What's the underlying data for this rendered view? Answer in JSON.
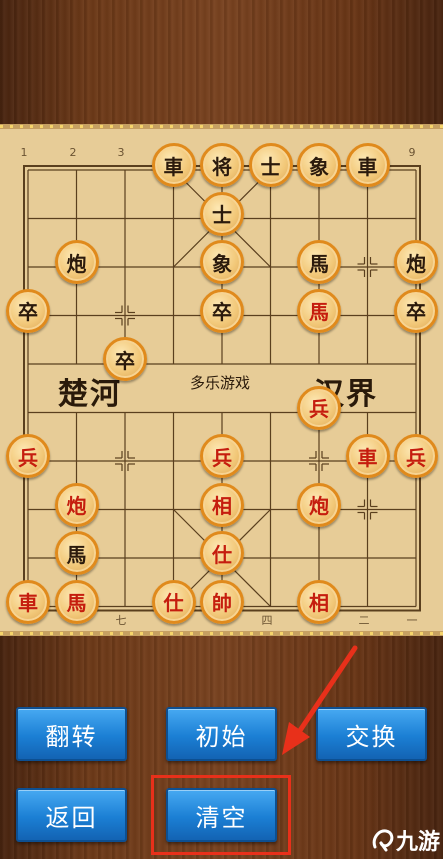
{
  "board": {
    "file_numbers_top": [
      "1",
      "2",
      "3",
      "9"
    ],
    "file_numbers_bottom": [
      "七",
      "四",
      "二",
      "一"
    ],
    "river": {
      "left": "楚河",
      "center": "多乐游戏",
      "right": "汉界"
    }
  },
  "pieces": [
    {
      "char": "車",
      "side": "black",
      "col": 3,
      "row": 0
    },
    {
      "char": "将",
      "side": "black",
      "col": 4,
      "row": 0
    },
    {
      "char": "士",
      "side": "black",
      "col": 5,
      "row": 0
    },
    {
      "char": "象",
      "side": "black",
      "col": 6,
      "row": 0
    },
    {
      "char": "車",
      "side": "black",
      "col": 7,
      "row": 0
    },
    {
      "char": "士",
      "side": "black",
      "col": 4,
      "row": 1
    },
    {
      "char": "炮",
      "side": "black",
      "col": 1,
      "row": 2
    },
    {
      "char": "象",
      "side": "black",
      "col": 4,
      "row": 2
    },
    {
      "char": "馬",
      "side": "black",
      "col": 6,
      "row": 2
    },
    {
      "char": "炮",
      "side": "black",
      "col": 8,
      "row": 2
    },
    {
      "char": "卒",
      "side": "black",
      "col": 0,
      "row": 3
    },
    {
      "char": "卒",
      "side": "black",
      "col": 4,
      "row": 3
    },
    {
      "char": "卒",
      "side": "black",
      "col": 8,
      "row": 3
    },
    {
      "char": "卒",
      "side": "black",
      "col": 2,
      "row": 4
    },
    {
      "char": "馬",
      "side": "red",
      "col": 6,
      "row": 3
    },
    {
      "char": "兵",
      "side": "red",
      "col": 6,
      "row": 5
    },
    {
      "char": "兵",
      "side": "red",
      "col": 0,
      "row": 6
    },
    {
      "char": "兵",
      "side": "red",
      "col": 4,
      "row": 6
    },
    {
      "char": "車",
      "side": "red",
      "col": 7,
      "row": 6
    },
    {
      "char": "兵",
      "side": "red",
      "col": 8,
      "row": 6
    },
    {
      "char": "炮",
      "side": "red",
      "col": 1,
      "row": 7
    },
    {
      "char": "相",
      "side": "red",
      "col": 4,
      "row": 7
    },
    {
      "char": "炮",
      "side": "red",
      "col": 6,
      "row": 7
    },
    {
      "char": "馬",
      "side": "black",
      "col": 1,
      "row": 8
    },
    {
      "char": "仕",
      "side": "red",
      "col": 4,
      "row": 8
    },
    {
      "char": "車",
      "side": "red",
      "col": 0,
      "row": 9
    },
    {
      "char": "馬",
      "side": "red",
      "col": 1,
      "row": 9
    },
    {
      "char": "仕",
      "side": "red",
      "col": 3,
      "row": 9
    },
    {
      "char": "帥",
      "side": "red",
      "col": 4,
      "row": 9
    },
    {
      "char": "相",
      "side": "red",
      "col": 6,
      "row": 9
    }
  ],
  "buttons": {
    "flip": "翻转",
    "initial": "初始",
    "swap": "交换",
    "back": "返回",
    "clear": "清空"
  },
  "logo": {
    "text": "九游"
  },
  "colors": {
    "highlight": "#e8301a",
    "button": "#1b7fd4",
    "red_piece_text": "#c51d0e",
    "black_piece_text": "#2b1a0c"
  }
}
